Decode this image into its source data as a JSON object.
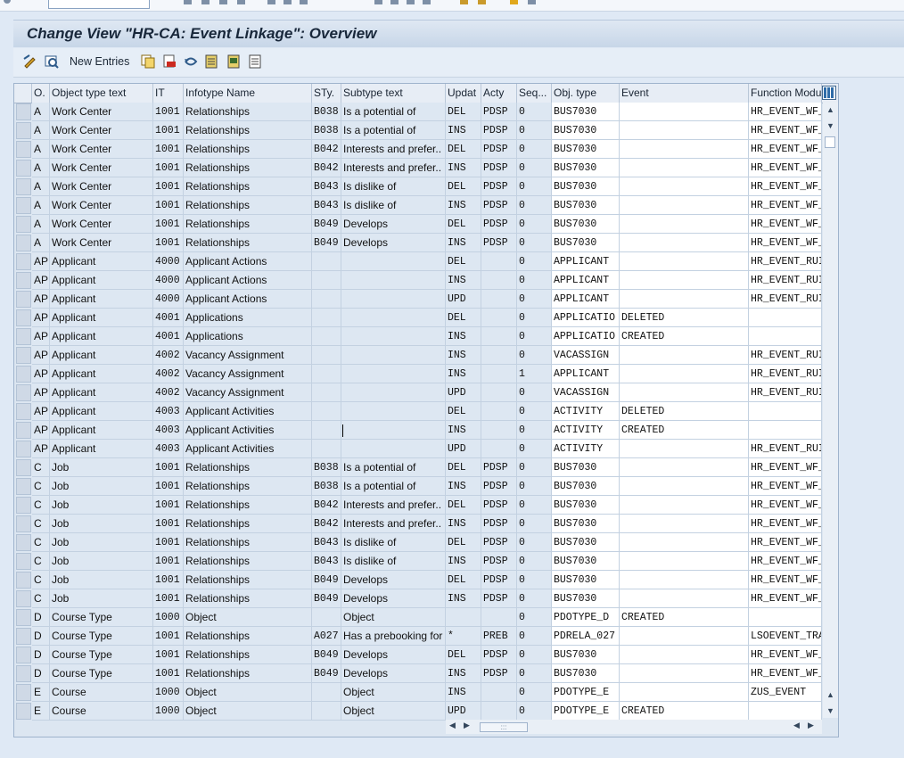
{
  "title": "Change View \"HR-CA: Event Linkage\": Overview",
  "toolbar": {
    "new_entries_label": "New Entries",
    "icons": [
      "change-display-icon",
      "details-icon",
      "copy-icon",
      "delete-icon",
      "undo-icon",
      "select-all-icon",
      "select-block-icon",
      "deselect-all-icon"
    ]
  },
  "columns": [
    "O.",
    "Object type text",
    "IT",
    "Infotype Name",
    "STy.",
    "Subtype text",
    "Updat",
    "Acty",
    "Seq...",
    "Obj. type",
    "Event",
    "Function Modu"
  ],
  "rows": [
    [
      "A",
      "Work Center",
      "1001",
      "Relationships",
      "B038",
      "Is a potential of",
      "DEL",
      "PDSP",
      "0",
      "BUS7030",
      "",
      "HR_EVENT_WF_"
    ],
    [
      "A",
      "Work Center",
      "1001",
      "Relationships",
      "B038",
      "Is a potential of",
      "INS",
      "PDSP",
      "0",
      "BUS7030",
      "",
      "HR_EVENT_WF_"
    ],
    [
      "A",
      "Work Center",
      "1001",
      "Relationships",
      "B042",
      "Interests and prefer..",
      "DEL",
      "PDSP",
      "0",
      "BUS7030",
      "",
      "HR_EVENT_WF_"
    ],
    [
      "A",
      "Work Center",
      "1001",
      "Relationships",
      "B042",
      "Interests and prefer..",
      "INS",
      "PDSP",
      "0",
      "BUS7030",
      "",
      "HR_EVENT_WF_"
    ],
    [
      "A",
      "Work Center",
      "1001",
      "Relationships",
      "B043",
      "Is dislike of",
      "DEL",
      "PDSP",
      "0",
      "BUS7030",
      "",
      "HR_EVENT_WF_"
    ],
    [
      "A",
      "Work Center",
      "1001",
      "Relationships",
      "B043",
      "Is dislike of",
      "INS",
      "PDSP",
      "0",
      "BUS7030",
      "",
      "HR_EVENT_WF_"
    ],
    [
      "A",
      "Work Center",
      "1001",
      "Relationships",
      "B049",
      "Develops",
      "DEL",
      "PDSP",
      "0",
      "BUS7030",
      "",
      "HR_EVENT_WF_"
    ],
    [
      "A",
      "Work Center",
      "1001",
      "Relationships",
      "B049",
      "Develops",
      "INS",
      "PDSP",
      "0",
      "BUS7030",
      "",
      "HR_EVENT_WF_"
    ],
    [
      "AP",
      "Applicant",
      "4000",
      "Applicant Actions",
      "",
      "",
      "DEL",
      "",
      "0",
      "APPLICANT",
      "",
      "HR_EVENT_RUI"
    ],
    [
      "AP",
      "Applicant",
      "4000",
      "Applicant Actions",
      "",
      "",
      "INS",
      "",
      "0",
      "APPLICANT",
      "",
      "HR_EVENT_RUI"
    ],
    [
      "AP",
      "Applicant",
      "4000",
      "Applicant Actions",
      "",
      "",
      "UPD",
      "",
      "0",
      "APPLICANT",
      "",
      "HR_EVENT_RUI"
    ],
    [
      "AP",
      "Applicant",
      "4001",
      "Applications",
      "",
      "",
      "DEL",
      "",
      "0",
      "APPLICATIO",
      "DELETED",
      ""
    ],
    [
      "AP",
      "Applicant",
      "4001",
      "Applications",
      "",
      "",
      "INS",
      "",
      "0",
      "APPLICATIO",
      "CREATED",
      ""
    ],
    [
      "AP",
      "Applicant",
      "4002",
      "Vacancy Assignment",
      "",
      "",
      "INS",
      "",
      "0",
      "VACASSIGN",
      "",
      "HR_EVENT_RUI"
    ],
    [
      "AP",
      "Applicant",
      "4002",
      "Vacancy Assignment",
      "",
      "",
      "INS",
      "",
      "1",
      "APPLICANT",
      "",
      "HR_EVENT_RUI"
    ],
    [
      "AP",
      "Applicant",
      "4002",
      "Vacancy Assignment",
      "",
      "",
      "UPD",
      "",
      "0",
      "VACASSIGN",
      "",
      "HR_EVENT_RUI"
    ],
    [
      "AP",
      "Applicant",
      "4003",
      "Applicant Activities",
      "",
      "",
      "DEL",
      "",
      "0",
      "ACTIVITY",
      "DELETED",
      ""
    ],
    [
      "AP",
      "Applicant",
      "4003",
      "Applicant Activities",
      "",
      "",
      "INS",
      "",
      "0",
      "ACTIVITY",
      "CREATED",
      ""
    ],
    [
      "AP",
      "Applicant",
      "4003",
      "Applicant Activities",
      "",
      "",
      "UPD",
      "",
      "0",
      "ACTIVITY",
      "",
      "HR_EVENT_RUI"
    ],
    [
      "C",
      "Job",
      "1001",
      "Relationships",
      "B038",
      "Is a potential of",
      "DEL",
      "PDSP",
      "0",
      "BUS7030",
      "",
      "HR_EVENT_WF_"
    ],
    [
      "C",
      "Job",
      "1001",
      "Relationships",
      "B038",
      "Is a potential of",
      "INS",
      "PDSP",
      "0",
      "BUS7030",
      "",
      "HR_EVENT_WF_"
    ],
    [
      "C",
      "Job",
      "1001",
      "Relationships",
      "B042",
      "Interests and prefer..",
      "DEL",
      "PDSP",
      "0",
      "BUS7030",
      "",
      "HR_EVENT_WF_"
    ],
    [
      "C",
      "Job",
      "1001",
      "Relationships",
      "B042",
      "Interests and prefer..",
      "INS",
      "PDSP",
      "0",
      "BUS7030",
      "",
      "HR_EVENT_WF_"
    ],
    [
      "C",
      "Job",
      "1001",
      "Relationships",
      "B043",
      "Is dislike of",
      "DEL",
      "PDSP",
      "0",
      "BUS7030",
      "",
      "HR_EVENT_WF_"
    ],
    [
      "C",
      "Job",
      "1001",
      "Relationships",
      "B043",
      "Is dislike of",
      "INS",
      "PDSP",
      "0",
      "BUS7030",
      "",
      "HR_EVENT_WF_"
    ],
    [
      "C",
      "Job",
      "1001",
      "Relationships",
      "B049",
      "Develops",
      "DEL",
      "PDSP",
      "0",
      "BUS7030",
      "",
      "HR_EVENT_WF_"
    ],
    [
      "C",
      "Job",
      "1001",
      "Relationships",
      "B049",
      "Develops",
      "INS",
      "PDSP",
      "0",
      "BUS7030",
      "",
      "HR_EVENT_WF_"
    ],
    [
      "D",
      "Course Type",
      "1000",
      "Object",
      "",
      "Object",
      "",
      "",
      "0",
      "PDOTYPE_D",
      "CREATED",
      ""
    ],
    [
      "D",
      "Course Type",
      "1001",
      "Relationships",
      "A027",
      "Has a prebooking for",
      "*",
      "PREB",
      "0",
      "PDRELA_027",
      "",
      "LSOEVENT_TRA"
    ],
    [
      "D",
      "Course Type",
      "1001",
      "Relationships",
      "B049",
      "Develops",
      "DEL",
      "PDSP",
      "0",
      "BUS7030",
      "",
      "HR_EVENT_WF_"
    ],
    [
      "D",
      "Course Type",
      "1001",
      "Relationships",
      "B049",
      "Develops",
      "INS",
      "PDSP",
      "0",
      "BUS7030",
      "",
      "HR_EVENT_WF_"
    ],
    [
      "E",
      "Course",
      "1000",
      "Object",
      "",
      "Object",
      "INS",
      "",
      "0",
      "PDOTYPE_E",
      "",
      "ZUS_EVENT"
    ],
    [
      "E",
      "Course",
      "1000",
      "Object",
      "",
      "Object",
      "UPD",
      "",
      "0",
      "PDOTYPE_E",
      "CREATED",
      ""
    ]
  ]
}
